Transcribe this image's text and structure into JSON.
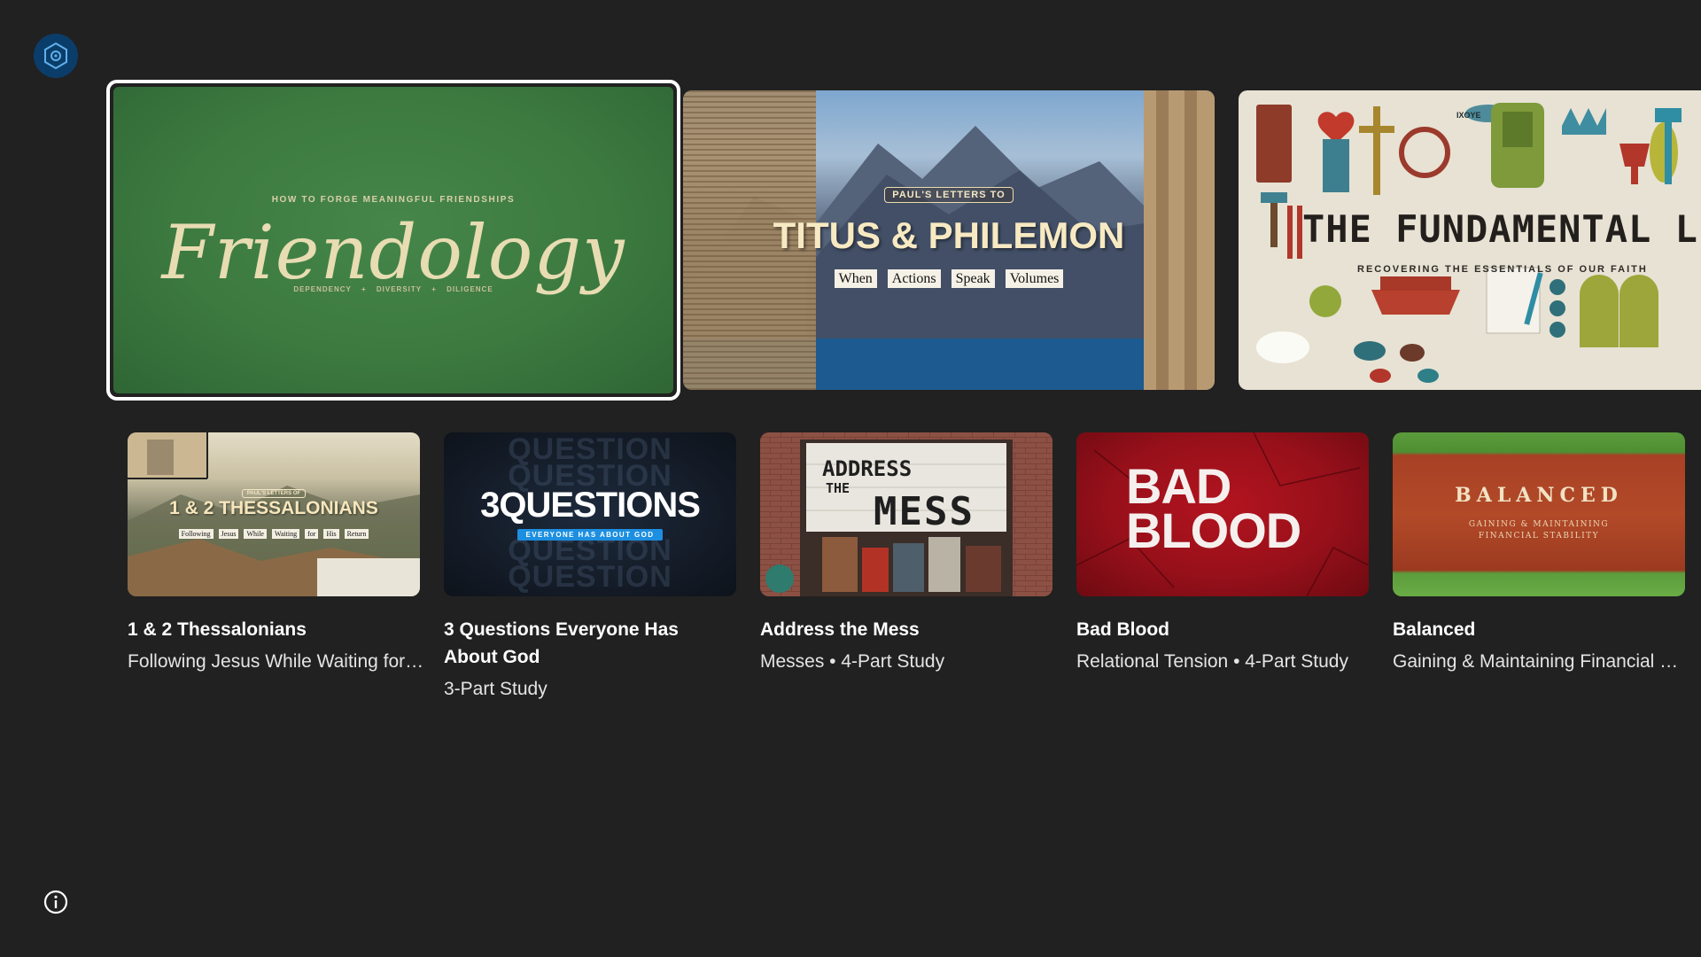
{
  "hero": {
    "items": [
      {
        "kicker": "HOW TO FORGE MEANINGFUL FRIENDSHIPS",
        "title": "Friendology",
        "tagline": [
          "DEPENDENCY",
          "DIVERSITY",
          "DILIGENCE"
        ]
      },
      {
        "kicker": "PAUL'S LETTERS TO",
        "title": "TITUS & PHILEMON",
        "tagline": [
          "When",
          "Actions",
          "Speak",
          "Volumes"
        ]
      },
      {
        "title": "THE FUNDAMENTAL LIST",
        "subtitle": "RECOVERING THE ESSENTIALS OF OUR FAITH",
        "fish_text": "IXOYE"
      }
    ]
  },
  "cards": [
    {
      "title": "1 & 2 Thessalonians",
      "subtitle": "Following Jesus While Waiting for His Return",
      "art": {
        "kicker": "PAUL'S LETTERS OF",
        "title": "1 & 2 THESSALONIANS",
        "words": [
          "Following",
          "Jesus",
          "While",
          "Waiting",
          "for",
          "His",
          "Return"
        ]
      }
    },
    {
      "title": "3 Questions Everyone Has About God",
      "subtitle": "3-Part Study",
      "art": {
        "title": "3QUESTIONS",
        "band": "EVERYONE HAS ABOUT GOD",
        "ghost": "QUESTION"
      }
    },
    {
      "title": "Address the Mess",
      "subtitle": "Messes • 4-Part Study",
      "art": {
        "line1": "ADDRESS",
        "line2": "THE",
        "line3": "MESS"
      }
    },
    {
      "title": "Bad Blood",
      "subtitle": "Relational Tension • 4-Part Study",
      "art": {
        "line1": "BAD",
        "line2": "BLOOD"
      }
    },
    {
      "title": "Balanced",
      "subtitle": "Gaining & Maintaining Financial Stability",
      "art": {
        "title": "BALANCED",
        "line1": "GAINING & MAINTAINING",
        "line2": "FINANCIAL STABILITY"
      }
    }
  ],
  "icons": {
    "app_logo": "hexagon-logo-icon",
    "info": "info-icon"
  },
  "colors": {
    "background": "#212121",
    "focus_ring": "#ffffff",
    "logo_bg": "#0b3d6b"
  }
}
